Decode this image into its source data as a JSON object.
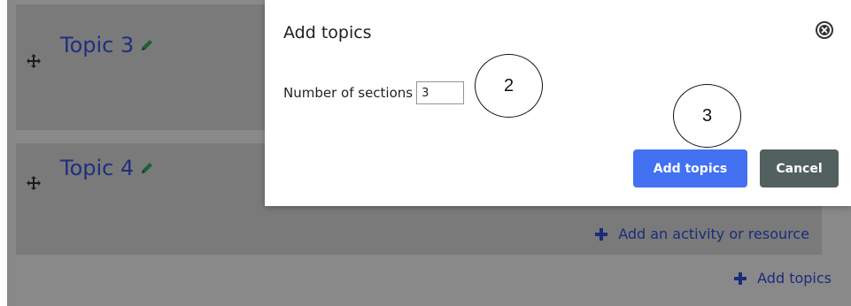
{
  "course": {
    "sections": [
      {
        "title": "Topic 3"
      },
      {
        "title": "Topic 4",
        "add_activity_label": "Add an activity or resource"
      }
    ],
    "add_topics_link": "Add topics"
  },
  "modal": {
    "title": "Add topics",
    "field_label": "Number of sections",
    "field_value": "3",
    "primary_button": "Add topics",
    "secondary_button": "Cancel"
  },
  "annotations": {
    "step_2": "2",
    "step_3": "3"
  },
  "icons": {
    "move": "move-icon",
    "edit": "pencil-icon",
    "add": "plus-icon",
    "close": "close-icon"
  },
  "colors": {
    "primary": "#4271f2",
    "secondary": "#52605f",
    "link": "#1a2c7a",
    "overlay": "#898989"
  }
}
